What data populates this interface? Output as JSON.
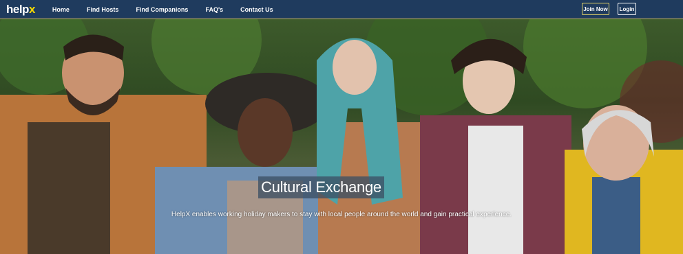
{
  "brand": {
    "main": "help",
    "accent": "x"
  },
  "nav": {
    "links": [
      "Home",
      "Find Hosts",
      "Find Companions",
      "FAQ's",
      "Contact Us"
    ],
    "join_label": "Join Now",
    "login_label": "Login"
  },
  "hero": {
    "title": "Cultural Exchange",
    "subtitle": "HelpX enables working holiday makers to stay with local people around the world and gain practical experience."
  },
  "colors": {
    "navbar": "#1f3b5e",
    "logo_accent": "#f2d600",
    "join_border": "#e6d66a"
  }
}
